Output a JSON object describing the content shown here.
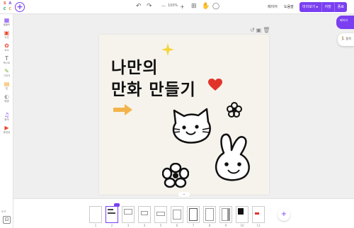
{
  "app": {
    "logo_letters": [
      "S",
      "A",
      "C",
      "C"
    ],
    "new_symbol": "+"
  },
  "toolbar": {
    "undo_icon": "undo-icon",
    "redo_icon": "redo-icon",
    "zoom_out": "—",
    "zoom_level": "100%",
    "zoom_in": "+",
    "grid_icon": "grid-icon",
    "hand_icon": "hand-icon",
    "comment_icon": "comment-icon",
    "menu_layer": "레이어",
    "menu_help": "도움말",
    "btn_preview": "미리보기",
    "btn_save": "저장",
    "btn_done": "종료"
  },
  "sidebar": {
    "items": [
      {
        "label": "템플릿",
        "icon": "▦",
        "color": "#7a3ff0"
      },
      {
        "label": "사진",
        "icon": "▣",
        "color": "#e8492e"
      },
      {
        "label": "요소",
        "icon": "✿",
        "color": "#e8492e"
      },
      {
        "label": "텍스트",
        "icon": "T",
        "color": "#666666"
      },
      {
        "label": "그리기",
        "icon": "✎",
        "color": "#7bb43a"
      },
      {
        "label": "표",
        "icon": "▤",
        "color": "#f0a020"
      },
      {
        "label": "배경",
        "icon": "◐",
        "color": "#aaaaaa"
      },
      {
        "label": "음악",
        "icon": "♫",
        "color": "#7a3ff0"
      },
      {
        "label": "동영상",
        "icon": "▶",
        "color": "#e8492e"
      }
    ],
    "bottom_label": "도구"
  },
  "right_panel": {
    "btn1_label": "페이지",
    "btn2_label": "동작"
  },
  "canvas": {
    "title_line1": "나만의",
    "title_line2": "만화 만들기",
    "tools": [
      "↺",
      "▣",
      "🗑"
    ]
  },
  "pages": {
    "numbers": [
      "1",
      "2",
      "3",
      "4",
      "5",
      "6",
      "7",
      "8",
      "9",
      "10",
      "11"
    ],
    "active": "2",
    "add_symbol": "+"
  },
  "colors": {
    "accent": "#7a3ff0",
    "heart": "#e0332a",
    "arrow": "#f2b44a",
    "sparkle": "#f4d53c"
  }
}
